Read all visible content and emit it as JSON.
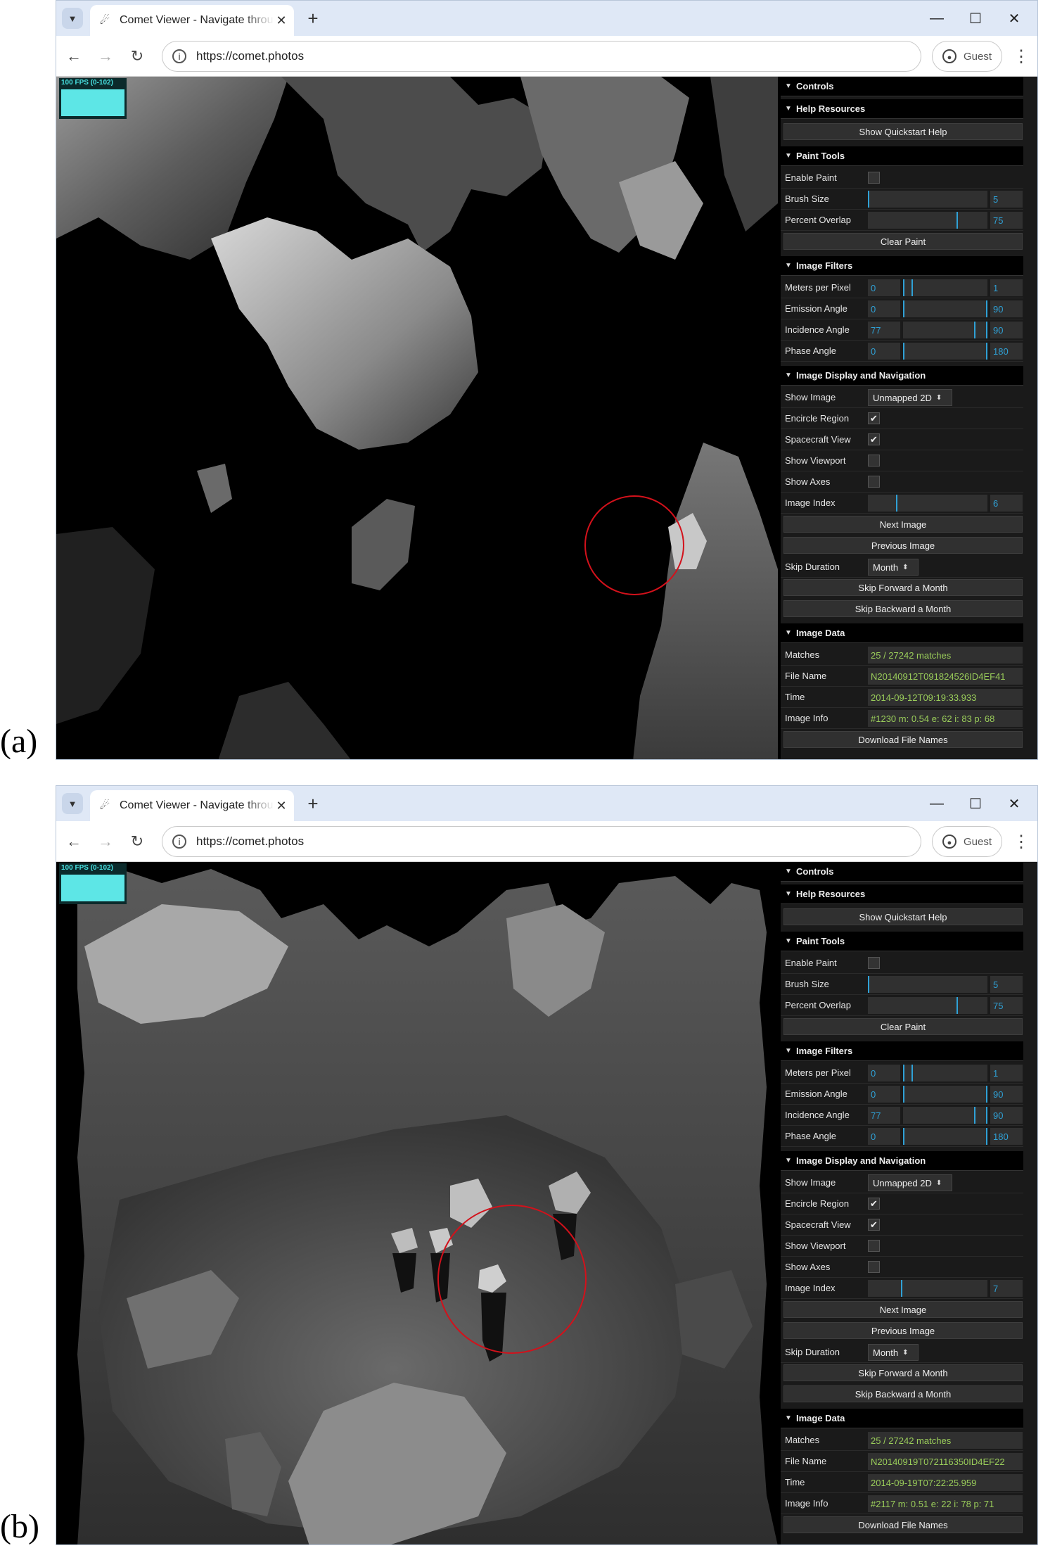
{
  "labels": [
    "(a)",
    "(b)"
  ],
  "browser": {
    "tab_title": "Comet Viewer - Navigate throu",
    "url": "https://comet.photos",
    "guest_label": "Guest"
  },
  "fps_text": "100 FPS (0-102)",
  "panels": [
    {
      "label": "(a)",
      "controls": {
        "controls_header": "Controls",
        "help_header": "Help Resources",
        "quickstart_button": "Show Quickstart Help",
        "paint_header": "Paint Tools",
        "enable_paint": {
          "label": "Enable Paint",
          "checked": false
        },
        "brush_size": {
          "label": "Brush Size",
          "value": "5",
          "fraction": 0.0
        },
        "percent_overlap": {
          "label": "Percent Overlap",
          "value": "75",
          "fraction": 0.75
        },
        "clear_paint_button": "Clear Paint",
        "filters_header": "Image Filters",
        "meters_per_pixel": {
          "label": "Meters per Pixel",
          "min": "0",
          "max": "1",
          "lo": 0.0,
          "hi": 0.1
        },
        "emission_angle": {
          "label": "Emission Angle",
          "min": "0",
          "max": "90",
          "lo": 0.0,
          "hi": 1.0
        },
        "incidence_angle": {
          "label": "Incidence Angle",
          "min": "77",
          "max": "90",
          "lo": 0.86,
          "hi": 1.0
        },
        "phase_angle": {
          "label": "Phase Angle",
          "min": "0",
          "max": "180",
          "lo": 0.0,
          "hi": 1.0
        },
        "display_header": "Image Display and Navigation",
        "show_image": {
          "label": "Show Image",
          "value": "Unmapped 2D"
        },
        "encircle_region": {
          "label": "Encircle Region",
          "checked": true
        },
        "spacecraft_view": {
          "label": "Spacecraft View",
          "checked": true
        },
        "show_viewport": {
          "label": "Show Viewport",
          "checked": false
        },
        "show_axes": {
          "label": "Show Axes",
          "checked": false
        },
        "image_index": {
          "label": "Image Index",
          "value": "6",
          "fraction": 0.24
        },
        "next_button": "Next Image",
        "prev_button": "Previous Image",
        "skip_duration": {
          "label": "Skip Duration",
          "value": "Month"
        },
        "skip_forward_button": "Skip Forward a Month",
        "skip_backward_button": "Skip Backward a Month",
        "data_header": "Image Data",
        "matches": {
          "label": "Matches",
          "value": "25 / 27242 matches"
        },
        "file_name": {
          "label": "File Name",
          "value": "N20140912T091824526ID4EF41"
        },
        "time": {
          "label": "Time",
          "value": "2014-09-12T09:19:33.933"
        },
        "image_info": {
          "label": "Image Info",
          "value": "#1230  m: 0.54  e: 62  i: 83  p: 68"
        },
        "download_button": "Download File Names"
      }
    },
    {
      "label": "(b)",
      "controls": {
        "controls_header": "Controls",
        "help_header": "Help Resources",
        "quickstart_button": "Show Quickstart Help",
        "paint_header": "Paint Tools",
        "enable_paint": {
          "label": "Enable Paint",
          "checked": false
        },
        "brush_size": {
          "label": "Brush Size",
          "value": "5",
          "fraction": 0.0
        },
        "percent_overlap": {
          "label": "Percent Overlap",
          "value": "75",
          "fraction": 0.75
        },
        "clear_paint_button": "Clear Paint",
        "filters_header": "Image Filters",
        "meters_per_pixel": {
          "label": "Meters per Pixel",
          "min": "0",
          "max": "1",
          "lo": 0.0,
          "hi": 0.1
        },
        "emission_angle": {
          "label": "Emission Angle",
          "min": "0",
          "max": "90",
          "lo": 0.0,
          "hi": 1.0
        },
        "incidence_angle": {
          "label": "Incidence Angle",
          "min": "77",
          "max": "90",
          "lo": 0.86,
          "hi": 1.0
        },
        "phase_angle": {
          "label": "Phase Angle",
          "min": "0",
          "max": "180",
          "lo": 0.0,
          "hi": 1.0
        },
        "display_header": "Image Display and Navigation",
        "show_image": {
          "label": "Show Image",
          "value": "Unmapped 2D"
        },
        "encircle_region": {
          "label": "Encircle Region",
          "checked": true
        },
        "spacecraft_view": {
          "label": "Spacecraft View",
          "checked": true
        },
        "show_viewport": {
          "label": "Show Viewport",
          "checked": false
        },
        "show_axes": {
          "label": "Show Axes",
          "checked": false
        },
        "image_index": {
          "label": "Image Index",
          "value": "7",
          "fraction": 0.28
        },
        "next_button": "Next Image",
        "prev_button": "Previous Image",
        "skip_duration": {
          "label": "Skip Duration",
          "value": "Month"
        },
        "skip_forward_button": "Skip Forward a Month",
        "skip_backward_button": "Skip Backward a Month",
        "data_header": "Image Data",
        "matches": {
          "label": "Matches",
          "value": "25 / 27242 matches"
        },
        "file_name": {
          "label": "File Name",
          "value": "N20140919T072116350ID4EF22"
        },
        "time": {
          "label": "Time",
          "value": "2014-09-19T07:22:25.959"
        },
        "image_info": {
          "label": "Image Info",
          "value": "#2117  m: 0.51  e: 22  i: 78  p: 71"
        },
        "download_button": "Download File Names"
      }
    }
  ]
}
